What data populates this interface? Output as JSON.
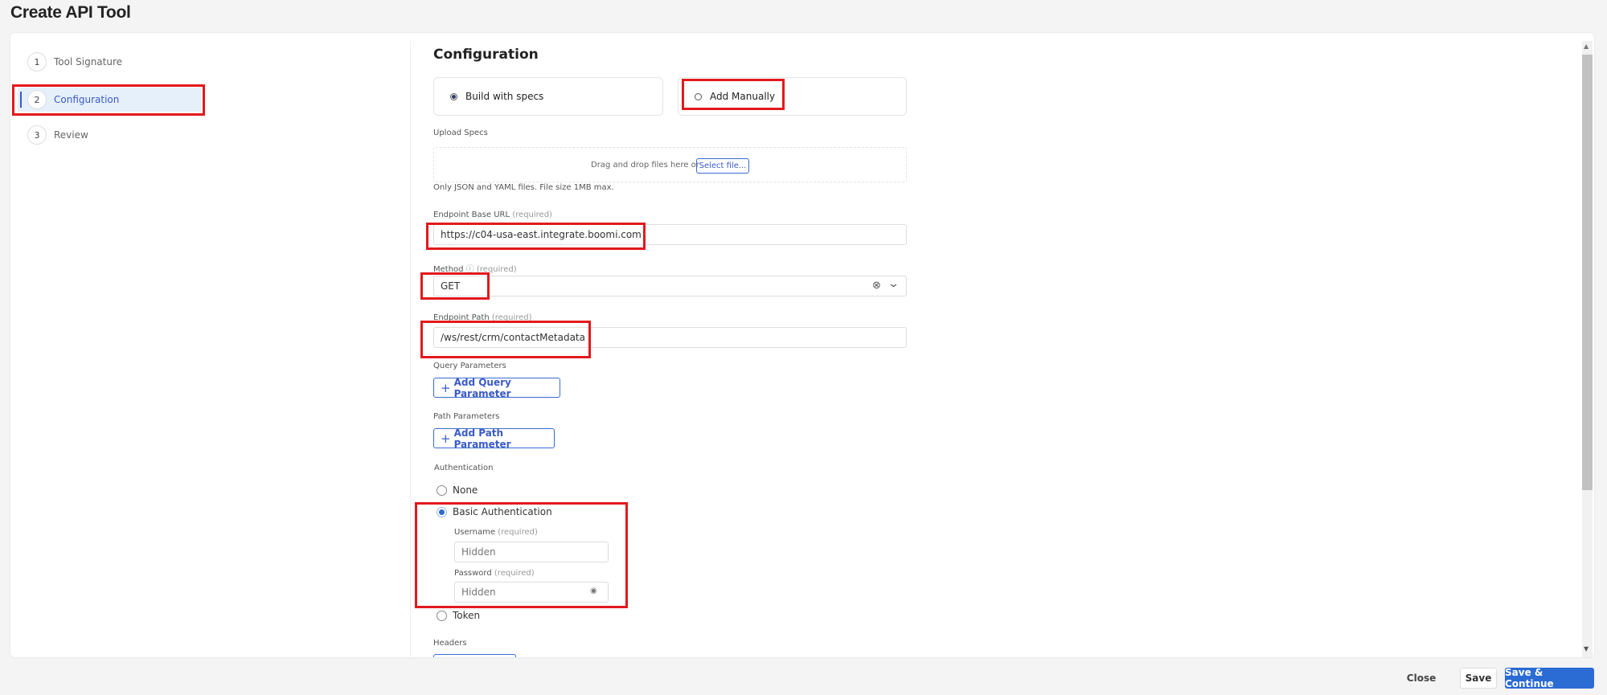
{
  "title": "Create API Tool",
  "steps": [
    {
      "num": "1",
      "label": "Tool Signature"
    },
    {
      "num": "2",
      "label": "Configuration"
    },
    {
      "num": "3",
      "label": "Review"
    }
  ],
  "main": {
    "heading": "Configuration",
    "modes": [
      {
        "label": "Build with specs",
        "selected": true
      },
      {
        "label": "Add Manually",
        "selected": false
      }
    ],
    "upload": {
      "label": "Upload Specs",
      "drop_text": "Drag and drop files here or",
      "select_button": "Select file...",
      "hint": "Only JSON and YAML files. File size 1MB max."
    },
    "base_url": {
      "label": "Endpoint Base URL",
      "req": "(required)",
      "value": "https://c04-usa-east.integrate.boomi.com"
    },
    "method": {
      "label": "Method",
      "req": "(required)",
      "value": "GET"
    },
    "path": {
      "label": "Endpoint Path",
      "req": "(required)",
      "value": "/ws/rest/crm/contactMetadata"
    },
    "query": {
      "label": "Query Parameters",
      "button": "Add Query Parameter"
    },
    "path_params": {
      "label": "Path Parameters",
      "button": "Add Path Parameter"
    },
    "auth": {
      "label": "Authentication",
      "options": [
        "None",
        "Basic Authentication",
        "Token"
      ],
      "selected": "Basic Authentication",
      "username": {
        "label": "Username",
        "req": "(required)",
        "placeholder": "Hidden"
      },
      "password": {
        "label": "Password",
        "req": "(required)",
        "placeholder": "Hidden"
      }
    },
    "headers": {
      "label": "Headers"
    }
  },
  "footer": {
    "close": "Close",
    "save": "Save",
    "save_continue": "Save & Continue"
  },
  "colors": {
    "accent": "#2b6bd4",
    "annotation": "#e3191c"
  }
}
